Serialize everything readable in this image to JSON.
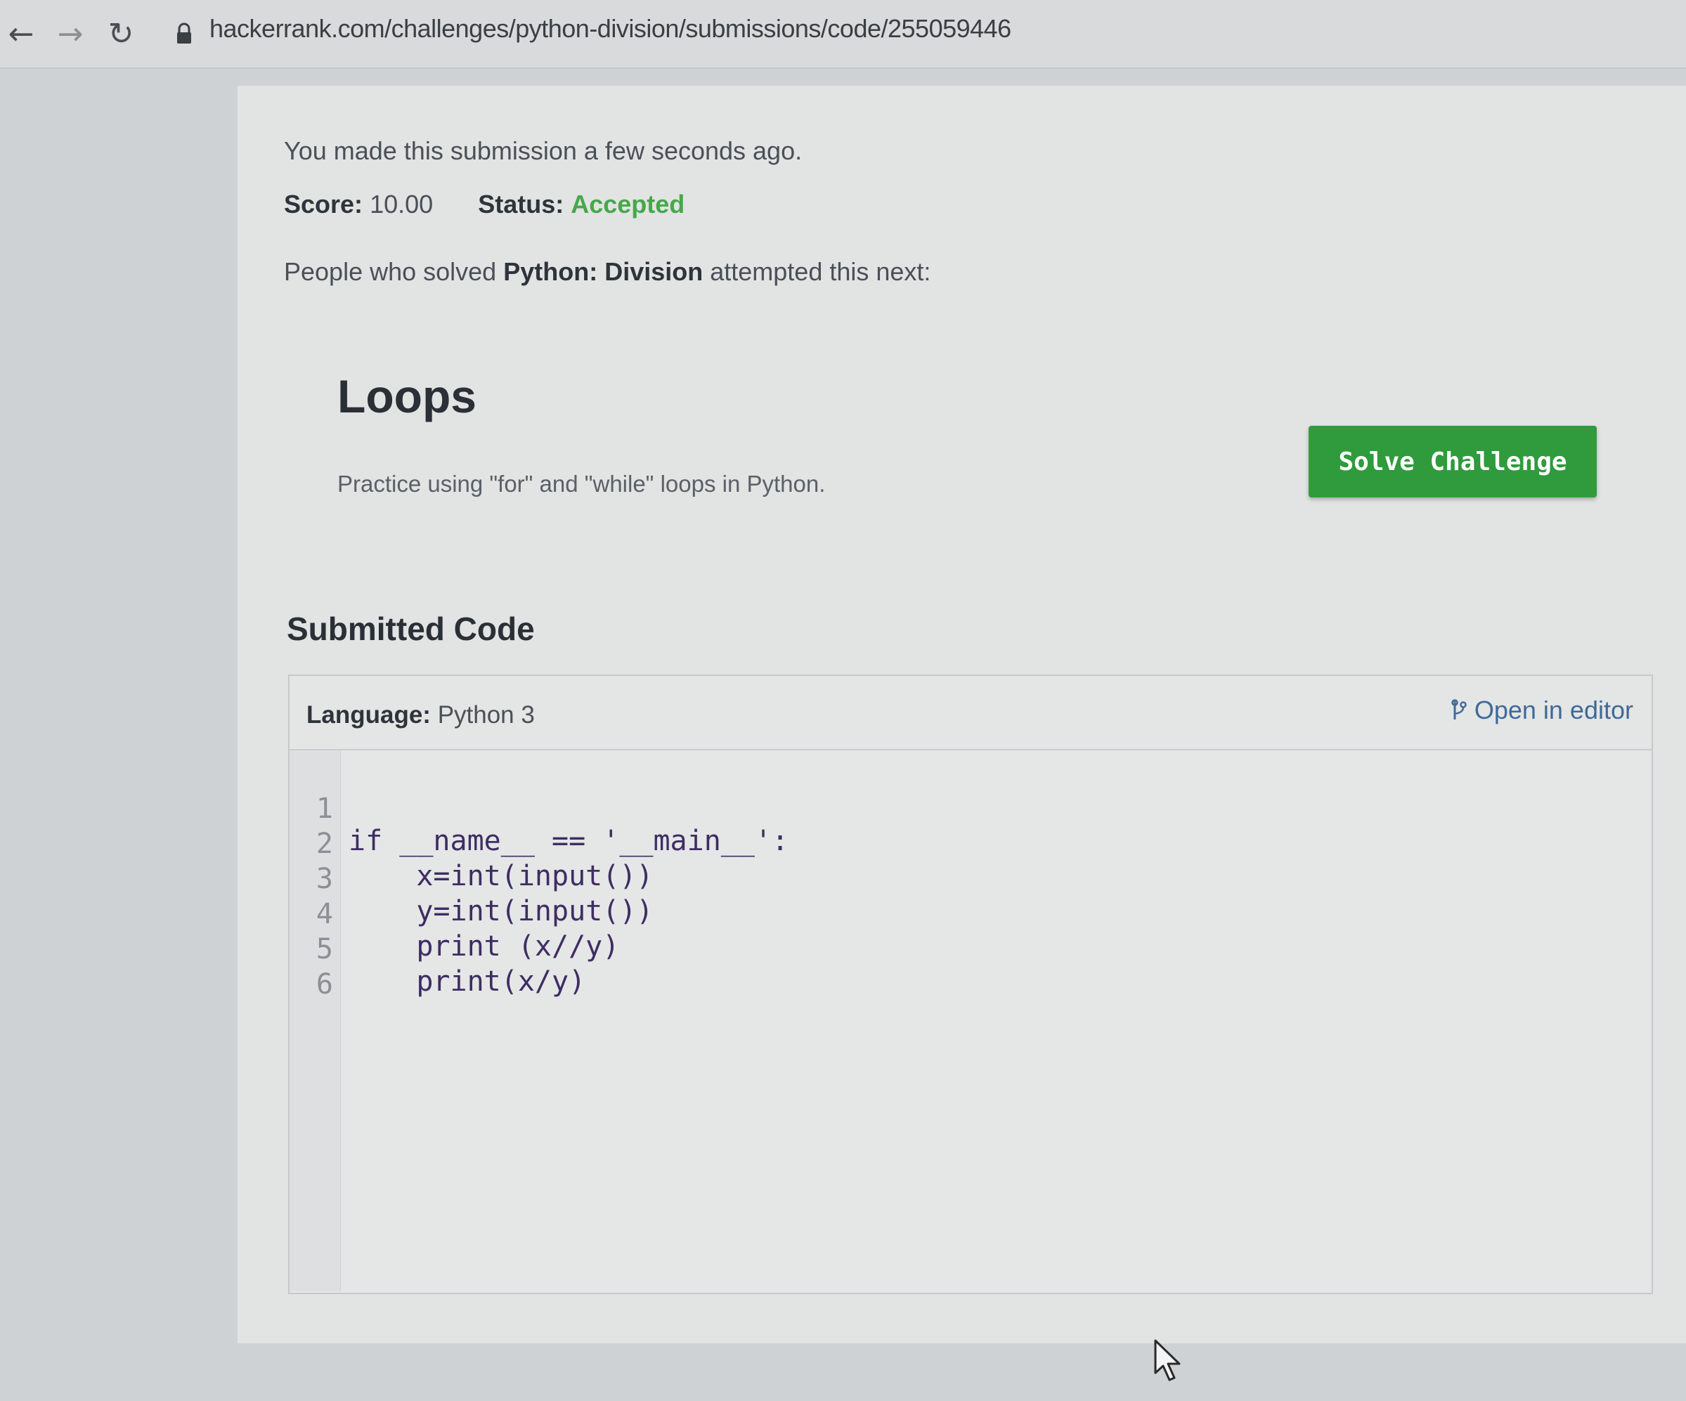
{
  "browser": {
    "url": "hackerrank.com/challenges/python-division/submissions/code/255059446",
    "back_glyph": "←",
    "forward_glyph": "→",
    "reload_glyph": "↻"
  },
  "submission": {
    "time_text": "You made this submission a few seconds ago.",
    "score_label": "Score:",
    "score_value": "10.00",
    "status_label": "Status:",
    "status_value": "Accepted",
    "next_prefix": "People who solved ",
    "next_challenge": "Python: Division",
    "next_suffix": " attempted this next:"
  },
  "recommended": {
    "title": "Loops",
    "description": "Practice using \"for\" and \"while\" loops in Python.",
    "button_label": "Solve Challenge"
  },
  "code_section": {
    "title": "Submitted Code",
    "language_label": "Language:",
    "language_value": "Python 3",
    "open_editor_label": "Open in editor",
    "lines": [
      {
        "num": "1",
        "text": "if __name__ == '__main__':"
      },
      {
        "num": "2",
        "text": "    x=int(input())"
      },
      {
        "num": "3",
        "text": "    y=int(input())"
      },
      {
        "num": "4",
        "text": "    print (x//y)"
      },
      {
        "num": "5",
        "text": "    print(x/y)"
      },
      {
        "num": "6",
        "text": ""
      }
    ]
  },
  "colors": {
    "accent_green": "#2f9b3c",
    "status_green": "#45a84a",
    "link_blue": "#3f6a99"
  }
}
